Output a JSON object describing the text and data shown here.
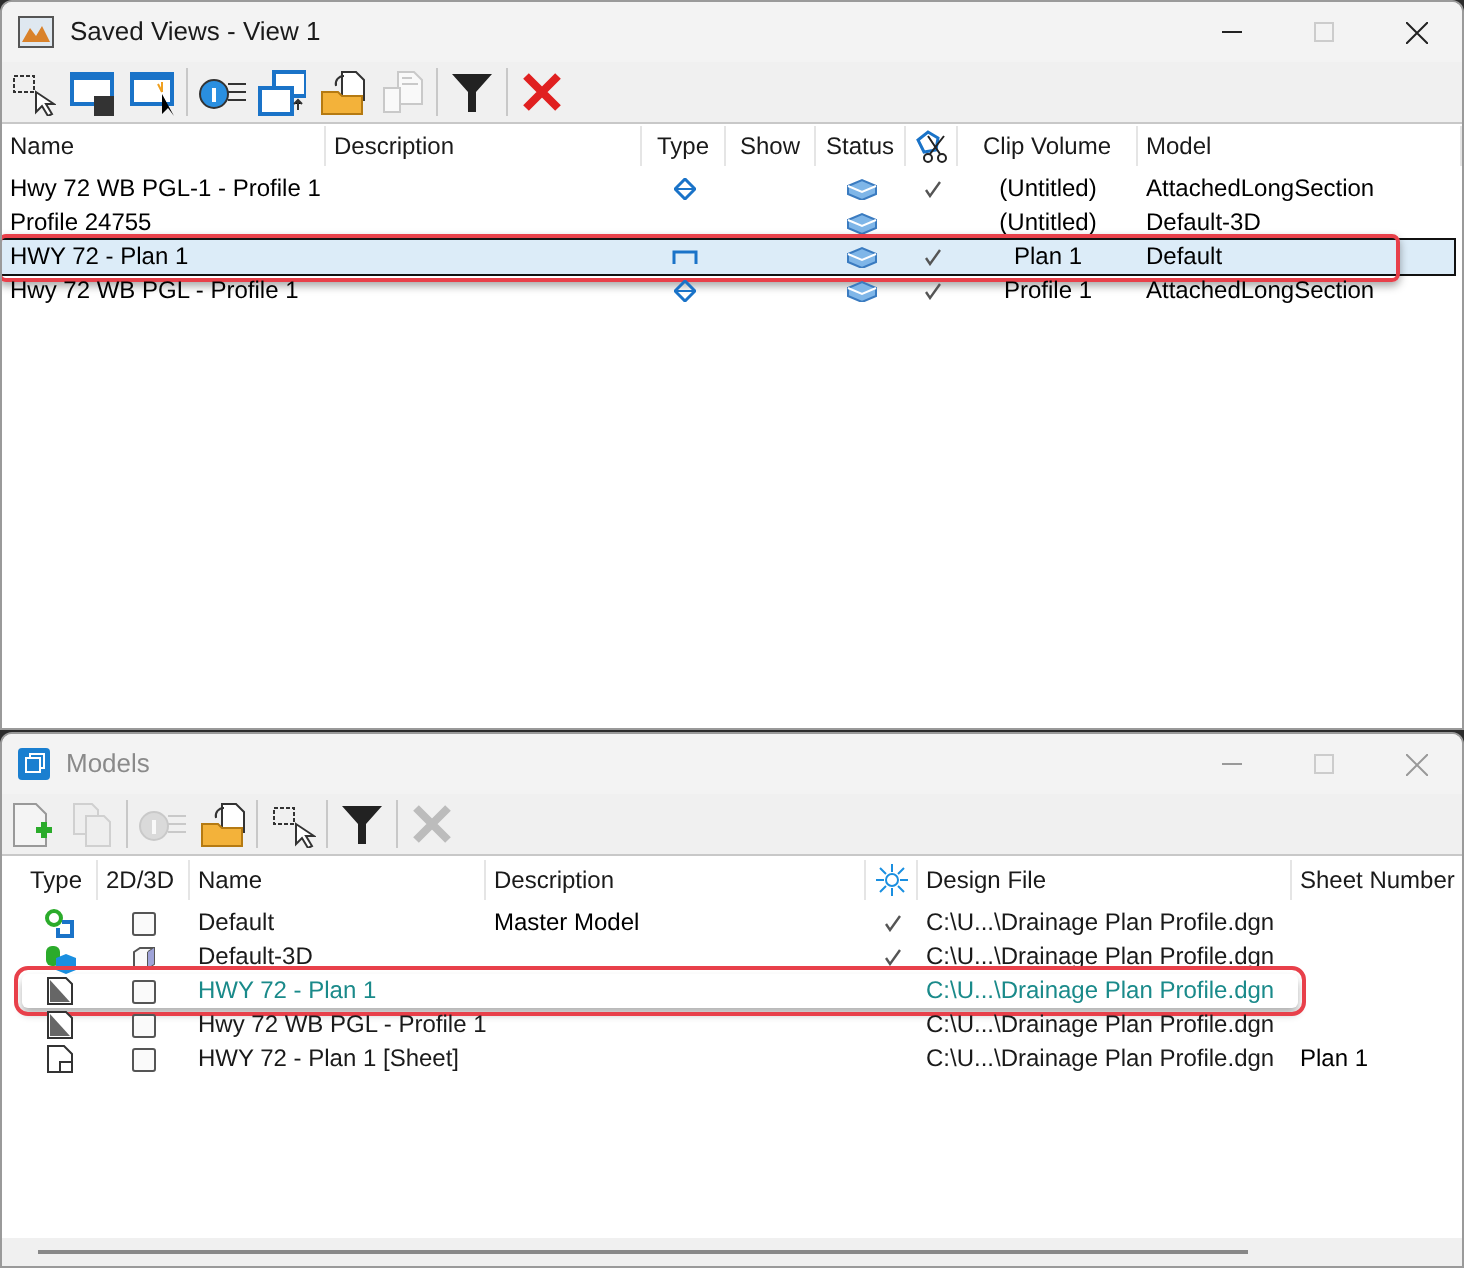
{
  "saved_views": {
    "title": "Saved Views - View 1",
    "active": true,
    "toolbar": [
      {
        "kind": "select",
        "disabled": false
      },
      {
        "kind": "save",
        "disabled": false
      },
      {
        "kind": "new",
        "disabled": false
      },
      {
        "kind": "info",
        "disabled": false
      },
      {
        "kind": "export",
        "disabled": false
      },
      {
        "kind": "import",
        "disabled": false
      },
      {
        "kind": "doc",
        "disabled": true
      },
      {
        "kind": "filter",
        "disabled": false
      },
      {
        "kind": "delete",
        "disabled": false
      }
    ],
    "columns": [
      "Name",
      "Description",
      "Type",
      "Show",
      "Status",
      "Clip Volume",
      "Model"
    ],
    "rows": [
      {
        "name": "Hwy 72 WB PGL-1 - Profile 1",
        "type_icon": {
          "kind": "profile"
        },
        "status_icon": {
          "kind": "volume"
        },
        "clip": true,
        "clip_volume": "(Untitled)",
        "model": "AttachedLongSection",
        "selected": false,
        "highlighted": false
      },
      {
        "name": "Profile 24755",
        "status_icon": {
          "kind": "volume"
        },
        "clip": false,
        "clip_volume": "(Untitled)",
        "model": "Default-3D",
        "selected": false,
        "highlighted": false
      },
      {
        "name": "HWY 72 - Plan 1",
        "type_icon": {
          "kind": "plan"
        },
        "status_icon": {
          "kind": "volume"
        },
        "clip": true,
        "clip_volume": "Plan 1",
        "model": "Default",
        "selected": true,
        "highlighted": true
      },
      {
        "name": "Hwy 72 WB PGL - Profile 1",
        "type_icon": {
          "kind": "profile"
        },
        "status_icon": {
          "kind": "volume"
        },
        "clip": true,
        "clip_volume": "Profile 1",
        "model": "AttachedLongSection",
        "selected": false,
        "highlighted": false
      }
    ]
  },
  "models": {
    "title": "Models",
    "active": false,
    "toolbar": [
      {
        "kind": "add",
        "disabled": false
      },
      {
        "kind": "copy",
        "disabled": true
      },
      {
        "kind": "info",
        "disabled": true
      },
      {
        "kind": "import",
        "disabled": false
      },
      {
        "kind": "select",
        "disabled": false
      },
      {
        "kind": "filter",
        "disabled": false
      },
      {
        "kind": "delete",
        "disabled": true
      }
    ],
    "columns": [
      "Type",
      "2D/3D",
      "Name",
      "Description",
      "Design File",
      "Sheet Number"
    ],
    "rows": [
      {
        "type_icon": {
          "kind": "design"
        },
        "dim_icon": {
          "kind": "checkbox"
        },
        "name": "Default",
        "description": "Master Model",
        "check": true,
        "design_file": "C:\\U...\\Drainage Plan Profile.dgn",
        "active": false,
        "highlighted": false
      },
      {
        "type_icon": {
          "kind": "design3d"
        },
        "dim_icon": {
          "kind": "cube"
        },
        "name": "Default-3D",
        "check": true,
        "design_file": "C:\\U...\\Drainage Plan Profile.dgn",
        "active": false,
        "highlighted": false
      },
      {
        "type_icon": {
          "kind": "drawing"
        },
        "dim_icon": {
          "kind": "checkbox"
        },
        "name": "HWY 72 - Plan 1",
        "check": false,
        "design_file": "C:\\U...\\Drainage Plan Profile.dgn",
        "active": true,
        "highlighted": true
      },
      {
        "type_icon": {
          "kind": "drawing"
        },
        "dim_icon": {
          "kind": "checkbox"
        },
        "name": "Hwy 72 WB PGL - Profile 1",
        "check": false,
        "design_file": "C:\\U...\\Drainage Plan Profile.dgn",
        "active": false,
        "highlighted": false
      },
      {
        "type_icon": {
          "kind": "sheet"
        },
        "dim_icon": {
          "kind": "checkbox"
        },
        "name": "HWY 72 - Plan 1 [Sheet]",
        "check": false,
        "design_file": "C:\\U...\\Drainage Plan Profile.dgn",
        "sheet_number": "Plan 1",
        "active": false,
        "highlighted": false
      }
    ]
  }
}
